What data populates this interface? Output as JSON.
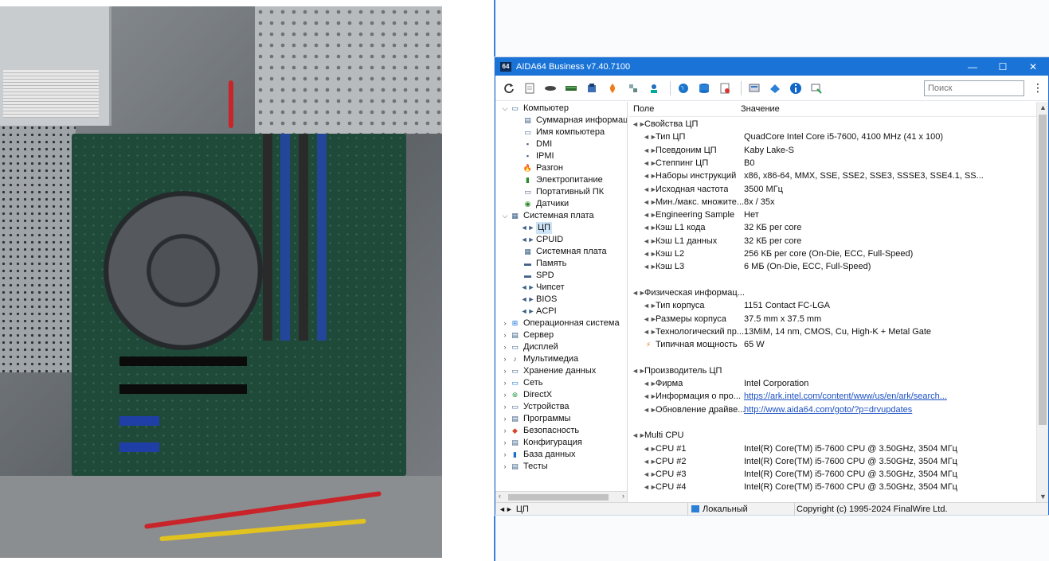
{
  "window": {
    "app_icon_text": "64",
    "title": "AIDA64 Business v7.40.7100",
    "controls": {
      "minimize": "—",
      "maximize": "☐",
      "close": "✕"
    }
  },
  "toolbar": {
    "icons": [
      "refresh-icon",
      "report-icon",
      "cpu-icon",
      "memory-icon",
      "benchmark-icon",
      "stress-icon",
      "network-icon",
      "remote-icon",
      "globe-icon",
      "database-icon",
      "audit-icon",
      "manager-icon",
      "share-icon",
      "info-icon",
      "compare-icon"
    ],
    "search_placeholder": "Поиск",
    "more": "⋮"
  },
  "tree": {
    "items": [
      {
        "label": "Компьютер",
        "level": 0,
        "expander": "⌵",
        "icon": "computer-icon"
      },
      {
        "label": "Суммарная информация",
        "level": 1,
        "icon": "summary-icon"
      },
      {
        "label": "Имя компьютера",
        "level": 1,
        "icon": "computer-name-icon"
      },
      {
        "label": "DMI",
        "level": 1,
        "icon": "dmi-icon"
      },
      {
        "label": "IPMI",
        "level": 1,
        "icon": "ipmi-icon"
      },
      {
        "label": "Разгон",
        "level": 1,
        "icon": "overclock-icon"
      },
      {
        "label": "Электропитание",
        "level": 1,
        "icon": "power-icon"
      },
      {
        "label": "Портативный ПК",
        "level": 1,
        "icon": "laptop-icon"
      },
      {
        "label": "Датчики",
        "level": 1,
        "icon": "sensor-icon"
      },
      {
        "label": "Системная плата",
        "level": 0,
        "expander": "⌵",
        "icon": "motherboard-icon"
      },
      {
        "label": "ЦП",
        "level": 1,
        "icon": "cpu-icon",
        "selected": true
      },
      {
        "label": "CPUID",
        "level": 1,
        "icon": "cpuid-icon"
      },
      {
        "label": "Системная плата",
        "level": 1,
        "icon": "board-icon"
      },
      {
        "label": "Память",
        "level": 1,
        "icon": "memory-icon"
      },
      {
        "label": "SPD",
        "level": 1,
        "icon": "spd-icon"
      },
      {
        "label": "Чипсет",
        "level": 1,
        "icon": "chipset-icon"
      },
      {
        "label": "BIOS",
        "level": 1,
        "icon": "bios-icon"
      },
      {
        "label": "ACPI",
        "level": 1,
        "icon": "acpi-icon"
      },
      {
        "label": "Операционная система",
        "level": 0,
        "expander": "›",
        "icon": "windows-icon"
      },
      {
        "label": "Сервер",
        "level": 0,
        "expander": "›",
        "icon": "server-icon"
      },
      {
        "label": "Дисплей",
        "level": 0,
        "expander": "›",
        "icon": "display-icon"
      },
      {
        "label": "Мультимедиа",
        "level": 0,
        "expander": "›",
        "icon": "multimedia-icon"
      },
      {
        "label": "Хранение данных",
        "level": 0,
        "expander": "›",
        "icon": "storage-icon"
      },
      {
        "label": "Сеть",
        "level": 0,
        "expander": "›",
        "icon": "network-icon"
      },
      {
        "label": "DirectX",
        "level": 0,
        "expander": "›",
        "icon": "directx-icon"
      },
      {
        "label": "Устройства",
        "level": 0,
        "expander": "›",
        "icon": "devices-icon"
      },
      {
        "label": "Программы",
        "level": 0,
        "expander": "›",
        "icon": "programs-icon"
      },
      {
        "label": "Безопасность",
        "level": 0,
        "expander": "›",
        "icon": "security-icon"
      },
      {
        "label": "Конфигурация",
        "level": 0,
        "expander": "›",
        "icon": "config-icon"
      },
      {
        "label": "База данных",
        "level": 0,
        "expander": "›",
        "icon": "database-icon"
      },
      {
        "label": "Тесты",
        "level": 0,
        "expander": "›",
        "icon": "tests-icon"
      }
    ],
    "scroll_left": "‹",
    "scroll_right": "›"
  },
  "list": {
    "col_field": "Поле",
    "col_value": "Значение",
    "rows": [
      {
        "type": "group",
        "field": "Свойства ЦП"
      },
      {
        "type": "item",
        "field": "Тип ЦП",
        "value": "QuadCore Intel Core i5-7600, 4100 MHz (41 x 100)"
      },
      {
        "type": "item",
        "field": "Псевдоним ЦП",
        "value": "Kaby Lake-S"
      },
      {
        "type": "item",
        "field": "Степпинг ЦП",
        "value": "B0"
      },
      {
        "type": "item",
        "field": "Наборы инструкций",
        "value": "x86, x86-64, MMX, SSE, SSE2, SSE3, SSSE3, SSE4.1, SS..."
      },
      {
        "type": "item",
        "field": "Исходная частота",
        "value": "3500 МГц"
      },
      {
        "type": "item",
        "field": "Мин./макс. множите...",
        "value": "8x / 35x"
      },
      {
        "type": "item",
        "field": "Engineering Sample",
        "value": "Нет"
      },
      {
        "type": "item",
        "field": "Кэш L1 кода",
        "value": "32 КБ per core"
      },
      {
        "type": "item",
        "field": "Кэш L1 данных",
        "value": "32 КБ per core"
      },
      {
        "type": "item",
        "field": "Кэш L2",
        "value": "256 КБ per core  (On-Die, ECC, Full-Speed)"
      },
      {
        "type": "item",
        "field": "Кэш L3",
        "value": "6 МБ  (On-Die, ECC, Full-Speed)"
      },
      {
        "type": "blank"
      },
      {
        "type": "group",
        "field": "Физическая информац..."
      },
      {
        "type": "item",
        "field": "Тип корпуса",
        "value": "1151 Contact FC-LGA"
      },
      {
        "type": "item",
        "field": "Размеры корпуса",
        "value": "37.5 mm x 37.5 mm"
      },
      {
        "type": "item",
        "field": "Технологический пр...",
        "value": "13MiM, 14 nm, CMOS, Cu, High-K + Metal Gate"
      },
      {
        "type": "item",
        "field": "Типичная мощность",
        "value": "65 W",
        "icon": "power-icon"
      },
      {
        "type": "blank"
      },
      {
        "type": "group",
        "field": "Производитель ЦП"
      },
      {
        "type": "item",
        "field": "Фирма",
        "value": "Intel Corporation"
      },
      {
        "type": "item",
        "field": "Информация о про...",
        "value": "https://ark.intel.com/content/www/us/en/ark/search...",
        "link": true
      },
      {
        "type": "item",
        "field": "Обновление драйве...",
        "value": "http://www.aida64.com/goto/?p=drvupdates",
        "link": true
      },
      {
        "type": "blank"
      },
      {
        "type": "group",
        "field": "Multi CPU"
      },
      {
        "type": "item",
        "field": "CPU #1",
        "value": "Intel(R) Core(TM) i5-7600 CPU @ 3.50GHz, 3504 МГц"
      },
      {
        "type": "item",
        "field": "CPU #2",
        "value": "Intel(R) Core(TM) i5-7600 CPU @ 3.50GHz, 3504 МГц"
      },
      {
        "type": "item",
        "field": "CPU #3",
        "value": "Intel(R) Core(TM) i5-7600 CPU @ 3.50GHz, 3504 МГц"
      },
      {
        "type": "item",
        "field": "CPU #4",
        "value": "Intel(R) Core(TM) i5-7600 CPU @ 3.50GHz, 3504 МГц"
      }
    ],
    "scroll_up": "▲",
    "scroll_down": "▼"
  },
  "statusbar": {
    "section": "ЦП",
    "mode": "Локальный",
    "copyright": "Copyright (c) 1995-2024 FinalWire Ltd."
  }
}
